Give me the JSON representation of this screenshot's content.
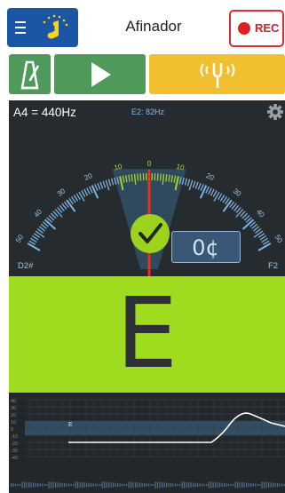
{
  "header": {
    "title": "Afinador",
    "rec_label": "REC",
    "menu_icon": "hamburger-icon",
    "logo_icon": "music-note-icon"
  },
  "controls": {
    "metronome_icon": "metronome-icon",
    "play_icon": "play-icon",
    "fork_icon": "tuning-fork-icon"
  },
  "meter": {
    "reference": "A4 = 440Hz",
    "note_frequency": "E2: 82Hz",
    "cents_display": "0¢",
    "low_note": "D2#",
    "high_note": "F2",
    "in_tune": true,
    "needle_cents": 0,
    "scale_labels": [
      "50",
      "40",
      "30",
      "20",
      "10",
      "0",
      "10",
      "20",
      "30",
      "40",
      "50"
    ]
  },
  "note": {
    "name": "E"
  },
  "graph": {
    "y_labels": [
      "40",
      "30",
      "20",
      "10",
      "0",
      "-10",
      "-20",
      "-30",
      "-40"
    ],
    "current_note_label": "E"
  },
  "colors": {
    "menu_blue": "#1a56a4",
    "rec_red": "#d83030",
    "control_green": "#4f9a5a",
    "fork_yellow": "#f0c030",
    "meter_bg": "#262b2f",
    "note_green": "#9fdb1f"
  }
}
